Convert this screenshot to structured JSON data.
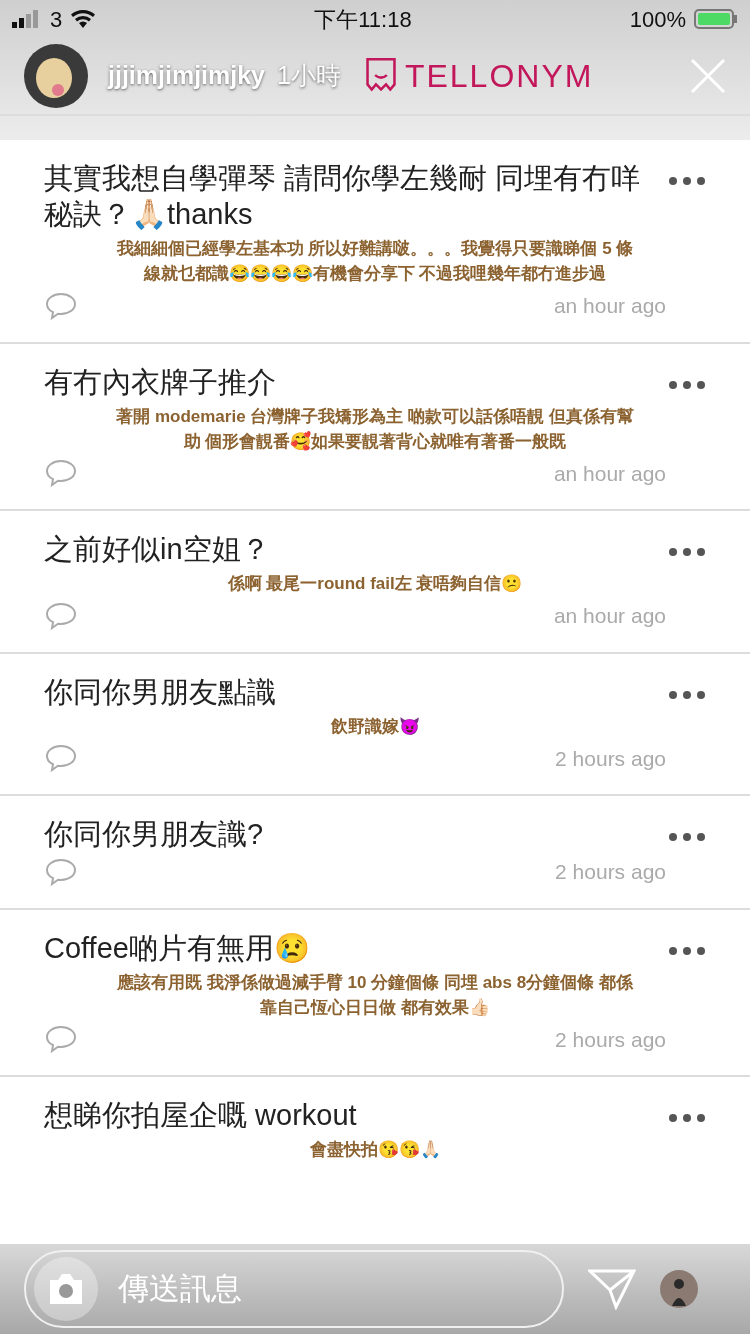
{
  "status_bar": {
    "carrier": "3",
    "time": "下午11:18",
    "battery": "100%"
  },
  "story": {
    "username": "jjjimjimjimjky",
    "age": "1小時",
    "reply_placeholder": "傳送訊息"
  },
  "app": {
    "logo": "TELLONYM"
  },
  "tells": [
    {
      "question": "其實我想自學彈琴 請問你學左幾耐 同埋有冇咩秘訣？🙏🏻thanks",
      "answer": "我細細個已經學左基本功 所以好難講啵。。。我覺得只要識睇個 5 條線就乜都識😂😂😂😂有機會分享下 不過我哩幾年都冇進步過",
      "time": "an hour ago"
    },
    {
      "question": "有冇內衣牌子推介",
      "answer": "著開 modemarie 台灣牌子我矯形為主 啲款可以話係唔靚 但真係有幫助 個形會靚番🥰如果要靚著背心就唯有著番一般既",
      "time": "an hour ago"
    },
    {
      "question": "之前好似in空姐？",
      "answer": "係啊 最尾一round fail左 衰唔夠自信😕",
      "time": "an hour ago"
    },
    {
      "question": "你同你男朋友點識",
      "time": "2 hours ago",
      "answer": "飲野識嫁😈"
    },
    {
      "question": "你同你男朋友識?",
      "time": "2 hours ago"
    },
    {
      "question": "Coffee啲片有無用😢",
      "answer": "應該有用既 我淨係做過減手臂 10 分鐘個條 同埋 abs 8分鐘個條 都係靠自己恆心日日做 都有效果👍🏻",
      "time": "2 hours ago"
    },
    {
      "question": "想睇你拍屋企嘅 workout",
      "answer": "會盡快拍😘😘🙏🏻"
    }
  ]
}
